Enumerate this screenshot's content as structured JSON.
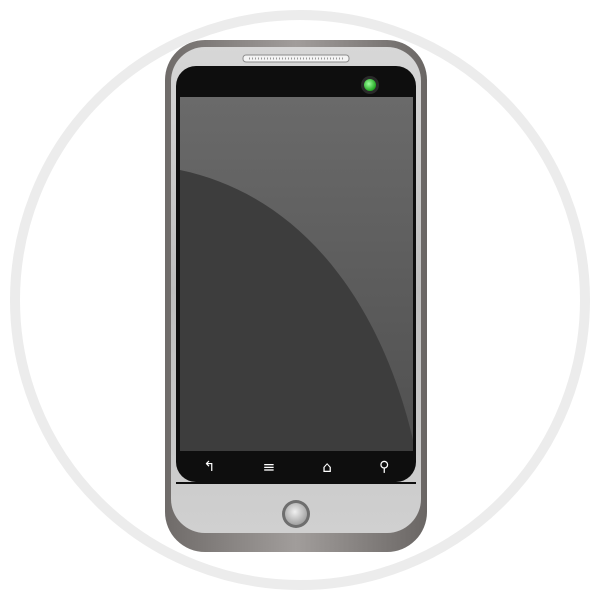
{
  "illustration": {
    "subject": "smartphone-icon",
    "ring_color": "#ececec",
    "body_color": "#8a8684",
    "bezel_color": "#c4c4c4",
    "screen_color": "#5a5a5a",
    "screen_shadow_color": "#3f3f3f",
    "led_color": "#3ecf3e"
  },
  "nav_bar": {
    "buttons": [
      {
        "name": "back-icon",
        "glyph": "↰"
      },
      {
        "name": "menu-icon",
        "glyph": "≡"
      },
      {
        "name": "home-icon",
        "glyph": "⌂"
      },
      {
        "name": "search-icon",
        "glyph": "⚲"
      }
    ]
  }
}
